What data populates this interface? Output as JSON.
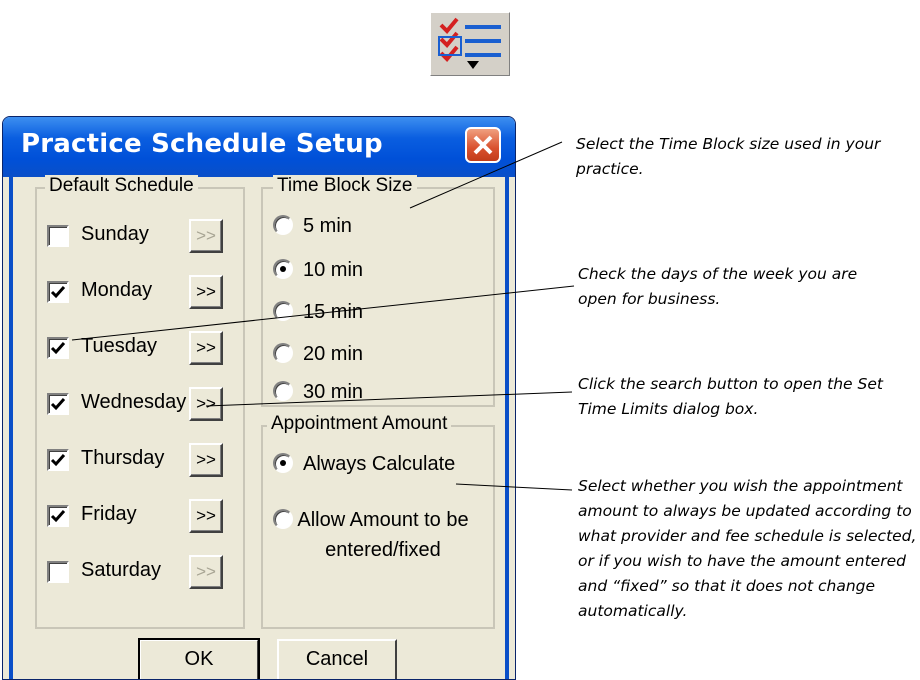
{
  "dialog": {
    "title": "Practice Schedule Setup",
    "ok_label": "OK",
    "cancel_label": "Cancel"
  },
  "default_schedule": {
    "label": "Default Schedule",
    "button_label": ">>",
    "days": [
      {
        "label": "Sunday",
        "checked": false,
        "button_enabled": false
      },
      {
        "label": "Monday",
        "checked": true,
        "button_enabled": true
      },
      {
        "label": "Tuesday",
        "checked": true,
        "button_enabled": true
      },
      {
        "label": "Wednesday",
        "checked": true,
        "button_enabled": true
      },
      {
        "label": "Thursday",
        "checked": true,
        "button_enabled": true
      },
      {
        "label": "Friday",
        "checked": true,
        "button_enabled": true
      },
      {
        "label": "Saturday",
        "checked": false,
        "button_enabled": false
      }
    ]
  },
  "time_block_size": {
    "label": "Time Block Size",
    "options": [
      {
        "label": "5 min",
        "selected": false
      },
      {
        "label": "10 min",
        "selected": true
      },
      {
        "label": "15 min",
        "selected": false
      },
      {
        "label": "20 min",
        "selected": false
      },
      {
        "label": "30 min",
        "selected": false
      }
    ]
  },
  "appointment_amount": {
    "label": "Appointment Amount",
    "options": [
      {
        "label": "Always Calculate",
        "selected": true
      },
      {
        "label": "Allow Amount to be entered/fixed",
        "selected": false
      }
    ]
  },
  "annotations": {
    "time_block": "Select the Time Block size used in your practice.",
    "days": "Check the days of the week you are open for business.",
    "search_button": "Click the search button to open the Set Time Limits dialog box.",
    "amount": "Select whether you wish the appointment amount to always be updated according to what provider and fee schedule is selected, or if you wish to have the amount entered and “fixed” so that it does not change automatically."
  },
  "icons": {
    "toolbar": "schedule-checklist-icon",
    "close": "close-icon"
  },
  "colors": {
    "titlebar": "#0a5ee0",
    "close_button": "#d9512e",
    "dialog_background": "#ece9d8",
    "checkmark_icon_red": "#d42020",
    "checkmark_icon_blue": "#1a5fd0"
  }
}
